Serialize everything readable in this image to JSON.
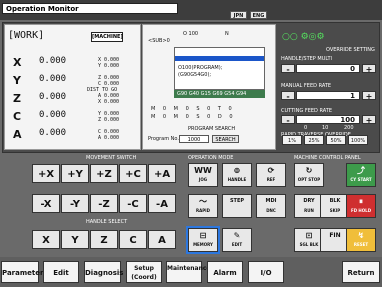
{
  "header": {
    "title": "Operation Monitor",
    "lang_jpn": "JPN",
    "lang_eng": "ENG"
  },
  "work": {
    "label": "[WORK]",
    "machine_label": "[MACHINE]",
    "axes": [
      {
        "name": "X",
        "value": "0.000",
        "sub": [
          "X 0.000",
          "Y 0.000"
        ]
      },
      {
        "name": "Y",
        "value": "0.000",
        "sub": [
          "Z 0.000",
          "C 0.000"
        ]
      },
      {
        "name": "Z",
        "value": "0.000",
        "sub": [
          "A 0.000",
          "X 0.000"
        ]
      },
      {
        "name": "C",
        "value": "0.000",
        "sub": [
          "Y 0.000",
          "Z 0.000"
        ]
      },
      {
        "name": "A",
        "value": "0.000",
        "sub": [
          "C 0.000",
          "A 0.000"
        ]
      }
    ],
    "dist_label": "DIST TO GO"
  },
  "info": {
    "block": "<SUB>0",
    "o_line": "O 100",
    "n_line": "N",
    "program_lines": [
      "O100(PROGRAM);",
      "(G90G54G0);",
      "",
      ""
    ],
    "modal": "G90 G40 G15 G69 G54 G94",
    "feed_row1": [
      "M",
      "0",
      "M",
      "0",
      "S",
      "0",
      "T",
      "0"
    ],
    "feed_row2": [
      "M",
      "0",
      "M",
      "0",
      "S",
      "0",
      "D",
      "0"
    ],
    "search_label": "PROGRAM SEARCH",
    "program_no_label": "Program No.",
    "program_no": "1000",
    "search_button": "SEARCH"
  },
  "override": {
    "title": "OVERRIDE SETTING",
    "handle_label": "HANDLE/STEP MULTI",
    "handle_value": "0",
    "manual_label": "MANUAL FEED RATE",
    "manual_value": "1",
    "cutting_label": "CUTTING FEED RATE",
    "cutting_value": "100",
    "scale": [
      "0",
      "10",
      "200"
    ],
    "rapid_label": "RAPID TRAVERSE OVERRIDE",
    "rapid_options": [
      "1%",
      "25%",
      "50%",
      "100%"
    ],
    "minus": "-",
    "plus": "+"
  },
  "sections": {
    "movement": "MOVEMENT SWITCH",
    "operation": "OPERATION MODE",
    "machine": "MACHINE CONTROL PANEL",
    "handle": "HANDLE SELECT"
  },
  "move_buttons": {
    "row1": [
      "+X",
      "+Y",
      "+Z",
      "+C",
      "+A"
    ],
    "row2": [
      "-X",
      "-Y",
      "-Z",
      "-C",
      "-A"
    ]
  },
  "handle_buttons": [
    "X",
    "Y",
    "Z",
    "C",
    "A"
  ],
  "operation_buttons": [
    {
      "icon": "WW",
      "label": "JOG"
    },
    {
      "icon": "⊚",
      "label": "HANDLE"
    },
    {
      "icon": "⟳",
      "label": "REF"
    },
    {
      "icon": "〜",
      "label": "RAPID"
    },
    {
      "icon": "STEP",
      "label": ""
    },
    {
      "icon": "MDI",
      "label": "DNC"
    },
    {
      "icon": "⊟",
      "label": "MEMORY"
    },
    {
      "icon": "✎",
      "label": "EDIT"
    }
  ],
  "machine_buttons": [
    {
      "icon": "↻",
      "label": "OPT STOP"
    },
    {
      "icon": "⤴",
      "label": "CY START"
    },
    {
      "icon": "DRY",
      "label": "RUN"
    },
    {
      "icon": "BLK",
      "label": "SKIP"
    },
    {
      "icon": "⏸",
      "label": "FD HOLD"
    },
    {
      "icon": "⊡",
      "label": "SGL BLK"
    },
    {
      "icon": "FIN",
      "label": ""
    },
    {
      "icon": "↯",
      "label": "RESET"
    }
  ],
  "function_buttons": [
    "Parameter",
    "Edit",
    "Diagnosis",
    "Setup (Coord)",
    "Maintenance",
    "Alarm",
    "I/O",
    "Return"
  ],
  "colors": {
    "background": "#6a6a6a",
    "panel": "#4b4b4b",
    "green": "#3d9b4b",
    "red": "#cf2f30",
    "yellow": "#f0be3a",
    "selected": "#2c77df"
  }
}
